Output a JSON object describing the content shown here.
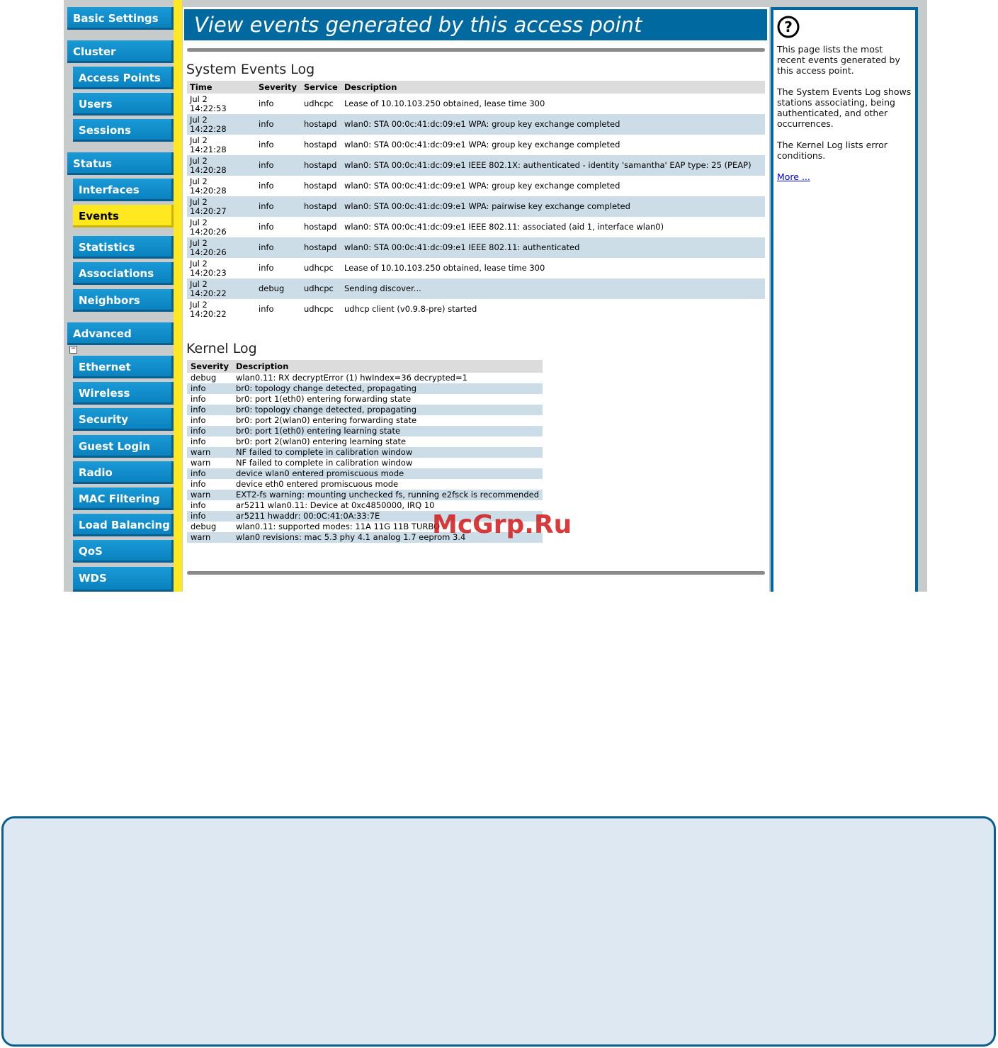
{
  "sidebar": {
    "basic_settings": "Basic Settings",
    "cluster": "Cluster",
    "access_points": "Access Points",
    "users": "Users",
    "sessions": "Sessions",
    "status": "Status",
    "interfaces": "Interfaces",
    "events": "Events",
    "statistics": "Statistics",
    "associations": "Associations",
    "neighbors": "Neighbors",
    "advanced": "Advanced",
    "collapse": "−",
    "ethernet": "Ethernet",
    "wireless": "Wireless",
    "security": "Security",
    "guest_login": "Guest Login",
    "radio": "Radio",
    "mac_filtering": "MAC Filtering",
    "load_balancing": "Load Balancing",
    "qos": "QoS",
    "wds": "WDS"
  },
  "header": {
    "title": "View events generated by this access point"
  },
  "system_log": {
    "title": "System Events Log",
    "columns": [
      "Time",
      "Severity",
      "Service",
      "Description"
    ],
    "rows": [
      {
        "date": "Jul 2",
        "time": "14:22:53",
        "severity": "info",
        "service": "udhcpc",
        "description": "Lease of 10.10.103.250 obtained, lease time 300"
      },
      {
        "date": "Jul 2",
        "time": "14:22:28",
        "severity": "info",
        "service": "hostapd",
        "description": "wlan0: STA 00:0c:41:dc:09:e1 WPA: group key exchange completed"
      },
      {
        "date": "Jul 2",
        "time": "14:21:28",
        "severity": "info",
        "service": "hostapd",
        "description": "wlan0: STA 00:0c:41:dc:09:e1 WPA: group key exchange completed"
      },
      {
        "date": "Jul 2",
        "time": "14:20:28",
        "severity": "info",
        "service": "hostapd",
        "description": "wlan0: STA 00:0c:41:dc:09:e1 IEEE 802.1X: authenticated - identity 'samantha' EAP type: 25 (PEAP)"
      },
      {
        "date": "Jul 2",
        "time": "14:20:28",
        "severity": "info",
        "service": "hostapd",
        "description": "wlan0: STA 00:0c:41:dc:09:e1 WPA: group key exchange completed"
      },
      {
        "date": "Jul 2",
        "time": "14:20:27",
        "severity": "info",
        "service": "hostapd",
        "description": "wlan0: STA 00:0c:41:dc:09:e1 WPA: pairwise key exchange completed"
      },
      {
        "date": "Jul 2",
        "time": "14:20:26",
        "severity": "info",
        "service": "hostapd",
        "description": "wlan0: STA 00:0c:41:dc:09:e1 IEEE 802.11: associated (aid 1, interface wlan0)"
      },
      {
        "date": "Jul 2",
        "time": "14:20:26",
        "severity": "info",
        "service": "hostapd",
        "description": "wlan0: STA 00:0c:41:dc:09:e1 IEEE 802.11: authenticated"
      },
      {
        "date": "Jul 2",
        "time": "14:20:23",
        "severity": "info",
        "service": "udhcpc",
        "description": "Lease of 10.10.103.250 obtained, lease time 300"
      },
      {
        "date": "Jul 2",
        "time": "14:20:22",
        "severity": "debug",
        "service": "udhcpc",
        "description": "Sending discover..."
      },
      {
        "date": "Jul 2",
        "time": "14:20:22",
        "severity": "info",
        "service": "udhcpc",
        "description": "udhcp client (v0.9.8-pre) started"
      }
    ]
  },
  "kernel_log": {
    "title": "Kernel Log",
    "columns": [
      "Severity",
      "Description"
    ],
    "rows": [
      {
        "severity": "debug",
        "description": "wlan0.11: RX decryptError (1) hwIndex=36 decrypted=1"
      },
      {
        "severity": "info",
        "description": "br0: topology change detected, propagating"
      },
      {
        "severity": "info",
        "description": "br0: port 1(eth0) entering forwarding state"
      },
      {
        "severity": "info",
        "description": "br0: topology change detected, propagating"
      },
      {
        "severity": "info",
        "description": "br0: port 2(wlan0) entering forwarding state"
      },
      {
        "severity": "info",
        "description": "br0: port 1(eth0) entering learning state"
      },
      {
        "severity": "info",
        "description": "br0: port 2(wlan0) entering learning state"
      },
      {
        "severity": "warn",
        "description": "NF failed to complete in calibration window"
      },
      {
        "severity": "warn",
        "description": "NF failed to complete in calibration window"
      },
      {
        "severity": "info",
        "description": "device wlan0 entered promiscuous mode"
      },
      {
        "severity": "info",
        "description": "device eth0 entered promiscuous mode"
      },
      {
        "severity": "warn",
        "description": "EXT2-fs warning: mounting unchecked fs, running e2fsck is recommended"
      },
      {
        "severity": "info",
        "description": "ar5211 wlan0.11: Device at 0xc4850000, IRQ 10"
      },
      {
        "severity": "info",
        "description": "ar5211 hwaddr: 00:0C:41:0A:33:7E"
      },
      {
        "severity": "debug",
        "description": "wlan0.11: supported modes: 11A 11G 11B TURBO"
      },
      {
        "severity": "warn",
        "description": "wlan0 revisions: mac 5.3 phy 4.1 analog 1.7 eeprom 3.4"
      }
    ]
  },
  "help": {
    "icon": "question-circle-icon",
    "p1": "This page lists the most recent events generated by this access point.",
    "p2": "The System Events Log shows stations associating, being authenticated, and other occurrences.",
    "p3": "The Kernel Log lists error conditions.",
    "more": "More ..."
  },
  "watermark": "McGrp.Ru",
  "colors": {
    "nav_blue": "#0a82c0",
    "active_yellow": "#ffe81f",
    "banner_blue": "#0069a0",
    "row_alt": "#ccdde8"
  }
}
